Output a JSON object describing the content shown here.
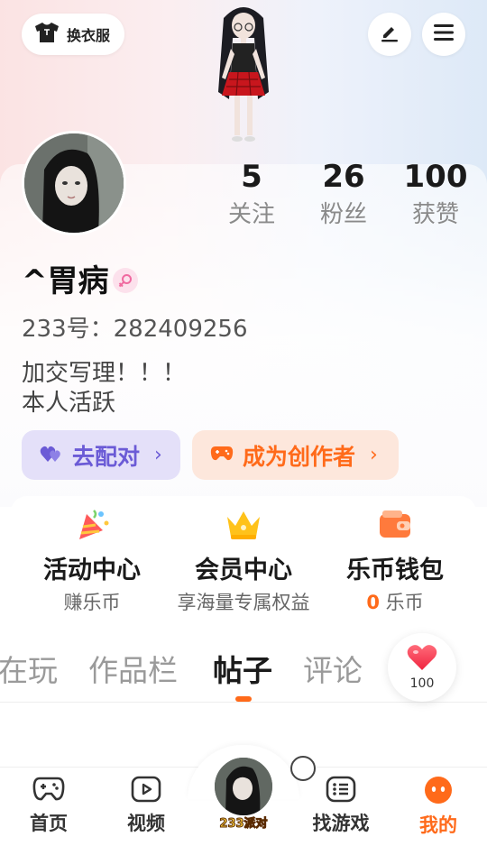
{
  "header": {
    "outfit_button_label": "换衣服",
    "icons": [
      "shirt-icon",
      "edit-icon",
      "menu-icon"
    ]
  },
  "profile": {
    "username": "^胃病",
    "gender": "female",
    "uid_text": "233号：282409256",
    "bio_line1": "加交写理！！！",
    "bio_line2": "本人活跃"
  },
  "stats": [
    {
      "value": "5",
      "label": "关注"
    },
    {
      "value": "26",
      "label": "粉丝"
    },
    {
      "value": "100",
      "label": "获赞"
    }
  ],
  "actions": {
    "match_label": "去配对",
    "creator_label": "成为创作者",
    "match_color": "#6b5bd6",
    "creator_color": "#ff6a1a"
  },
  "services": [
    {
      "title": "活动中心",
      "subtitle": "赚乐币",
      "icon": "party-popper-icon"
    },
    {
      "title": "会员中心",
      "subtitle": "享海量专属权益",
      "icon": "crown-icon"
    },
    {
      "title": "乐币钱包",
      "subtitle_amount": "0",
      "subtitle_unit": "乐币",
      "icon": "wallet-icon"
    }
  ],
  "tabs": [
    "在玩",
    "作品栏",
    "帖子",
    "评论"
  ],
  "active_tab": "帖子",
  "like_bubble": {
    "count": "100"
  },
  "bottom_nav": {
    "items": [
      "首页",
      "视频",
      "找游戏",
      "我的"
    ],
    "center_label": "233派对",
    "active": "我的",
    "accent": "#ff6a1a"
  }
}
